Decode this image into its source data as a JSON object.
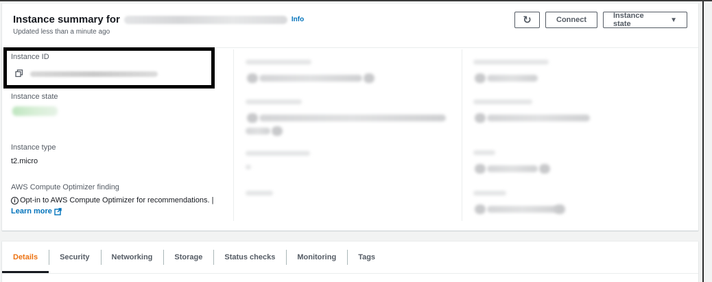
{
  "header": {
    "title": "Instance summary for",
    "info_link": "Info",
    "updated": "Updated less than a minute ago",
    "refresh_glyph": "↻",
    "connect_label": "Connect",
    "instance_state_label": "Instance state",
    "caret_glyph": "▼"
  },
  "fields": {
    "instance_id_label": "Instance ID",
    "instance_state_label": "Instance state",
    "instance_type_label": "Instance type",
    "instance_type_value": "t2.micro",
    "optimizer_label": "AWS Compute Optimizer finding",
    "optimizer_text": "Opt-in to AWS Compute Optimizer for recommendations. |",
    "info_glyph": "i",
    "learn_more": "Learn more"
  },
  "icons": {
    "refresh": "refresh-icon",
    "caret": "caret-down-icon",
    "copy": "copy-icon",
    "info": "info-circle-icon",
    "external": "external-link-icon"
  },
  "tabs": [
    {
      "label": "Details",
      "active": true
    },
    {
      "label": "Security",
      "active": false
    },
    {
      "label": "Networking",
      "active": false
    },
    {
      "label": "Storage",
      "active": false
    },
    {
      "label": "Status checks",
      "active": false
    },
    {
      "label": "Monitoring",
      "active": false
    },
    {
      "label": "Tags",
      "active": false
    }
  ],
  "colors": {
    "accent_link": "#0073bb",
    "active_tab": "#ec7211",
    "highlight_box": "#000000"
  }
}
